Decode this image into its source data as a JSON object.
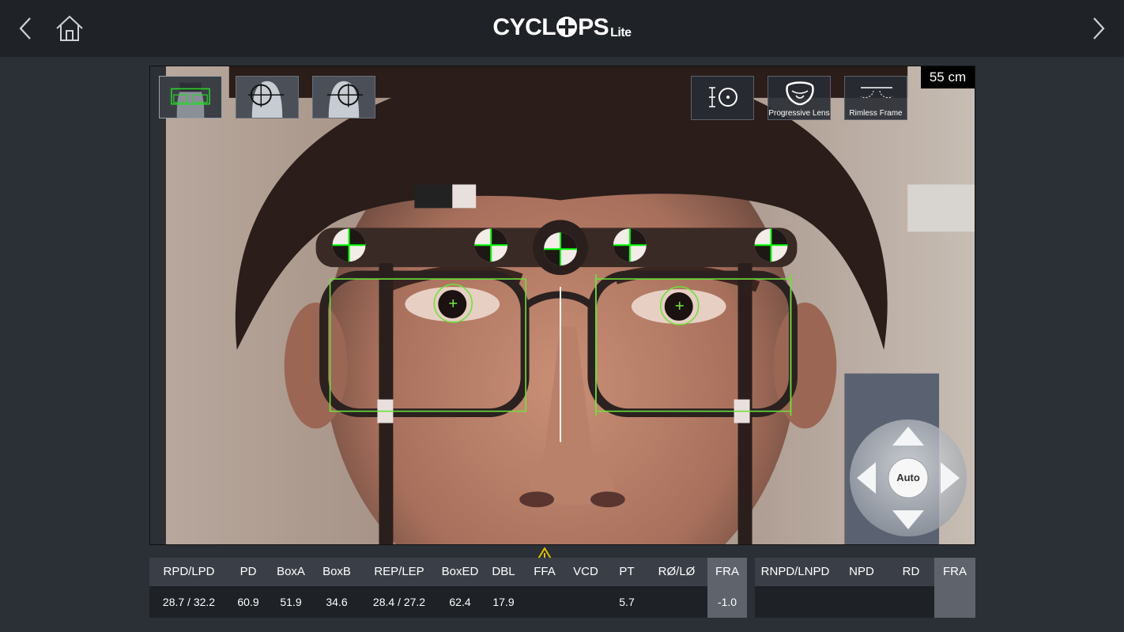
{
  "app": {
    "logo_text": "CYCL",
    "logo_text_end": "PS",
    "logo_suffix": "Lite"
  },
  "topbar": {
    "back_icon": "chevron-left-icon",
    "home_icon": "home-icon",
    "forward_icon": "chevron-right-icon"
  },
  "viewport": {
    "distance": "55 cm",
    "mode_thumbs": [
      "frame-fitting-mode",
      "near-vision-mode",
      "far-vision-mode"
    ],
    "tools": [
      {
        "icon": "vertex-distance-icon",
        "label": ""
      },
      {
        "icon": "progressive-lens-icon",
        "label": "Progressive Lens"
      },
      {
        "icon": "rimless-frame-icon",
        "label": "Rimless Frame"
      }
    ],
    "dpad_center": "Auto",
    "overlay_color": "#00ff00"
  },
  "measurements": {
    "headers": [
      "RPD/LPD",
      "PD",
      "BoxA",
      "BoxB",
      "REP/LEP",
      "BoxED",
      "DBL",
      "FFA",
      "VCD",
      "PT",
      "RØ/LØ",
      "FRA"
    ],
    "values": [
      "28.7 / 32.2",
      "60.9",
      "51.9",
      "34.6",
      "28.4 / 27.2",
      "62.4",
      "17.9",
      "",
      "",
      "5.7",
      "",
      "-1.0"
    ],
    "warning_icon": "warning-triangle-icon",
    "warning_color": "#e0c000"
  },
  "near_measurements": {
    "headers": [
      "RNPD/LNPD",
      "NPD",
      "RD",
      "FRA"
    ],
    "values": [
      "",
      "",
      "",
      ""
    ]
  }
}
